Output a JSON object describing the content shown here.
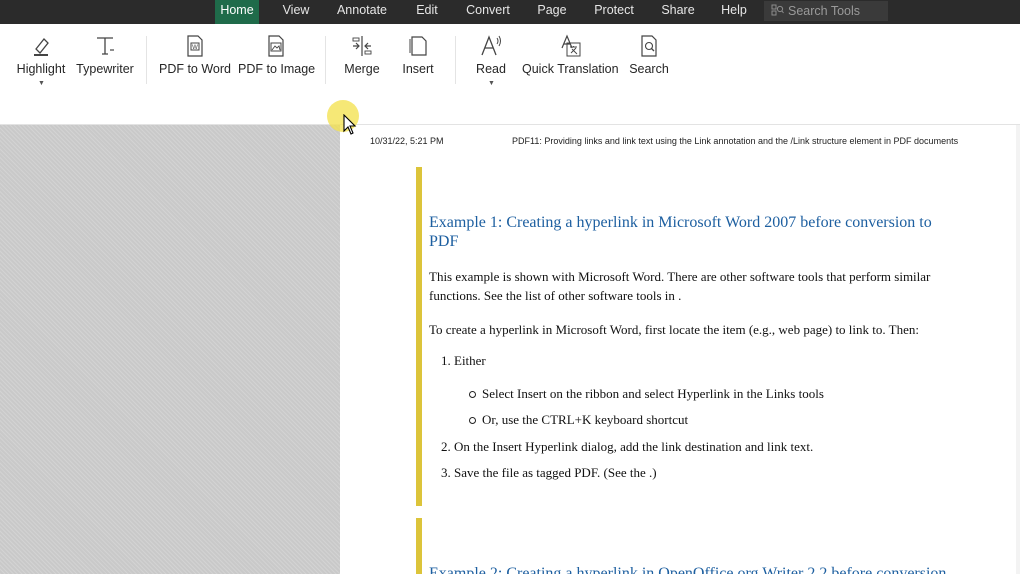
{
  "menubar": {
    "items": [
      {
        "label": "Home",
        "active": true
      },
      {
        "label": "View"
      },
      {
        "label": "Annotate"
      },
      {
        "label": "Edit"
      },
      {
        "label": "Convert"
      },
      {
        "label": "Page"
      },
      {
        "label": "Protect"
      },
      {
        "label": "Share"
      },
      {
        "label": "Help"
      }
    ],
    "search_placeholder": "Search Tools"
  },
  "ribbon": {
    "tools": [
      {
        "label": "Highlight",
        "icon": "highlighter-icon",
        "has_dropdown": true
      },
      {
        "label": "Typewriter",
        "icon": "typewriter-icon"
      },
      {
        "label": "PDF to Word",
        "icon": "pdf-to-word-icon"
      },
      {
        "label": "PDF to Image",
        "icon": "pdf-to-image-icon"
      },
      {
        "label": "Merge",
        "icon": "merge-icon"
      },
      {
        "label": "Insert",
        "icon": "insert-page-icon"
      },
      {
        "label": "Read",
        "icon": "read-aloud-icon",
        "has_dropdown": true
      },
      {
        "label": "Quick Translation",
        "icon": "translate-icon"
      },
      {
        "label": "Search",
        "icon": "search-document-icon"
      }
    ]
  },
  "colors": {
    "menubar_bg": "#2b2b2b",
    "active_tab": "#1f6b4a",
    "heading_link": "#1d5fa0",
    "accent_bar": "#dcc43a",
    "cursor_halo": "#f4e250"
  },
  "document": {
    "header_left": "10/31/22, 5:21 PM",
    "header_right": "PDF11: Providing links and link text using the Link annotation and the /Link structure element in PDF documents",
    "example1": {
      "heading": "Example 1: Creating a hyperlink in Microsoft Word 2007 before conversion to PDF",
      "para1": "This example is shown with Microsoft Word. There are other software tools that perform similar functions. See the list of other software tools in .",
      "para2": "To create a hyperlink in Microsoft Word, first locate the item (e.g., web page) to link to. Then:",
      "steps": [
        "1. Either",
        "2. On the Insert Hyperlink dialog, add the link destination and link text.",
        "3. Save the file as tagged PDF. (See the .)"
      ],
      "substeps": [
        "Select Insert on the ribbon and select Hyperlink in the Links tools",
        "Or, use the CTRL+K keyboard shortcut"
      ]
    },
    "example2": {
      "heading": "Example 2: Creating a hyperlink in OpenOffice.org Writer 2.2 before conversion"
    }
  }
}
